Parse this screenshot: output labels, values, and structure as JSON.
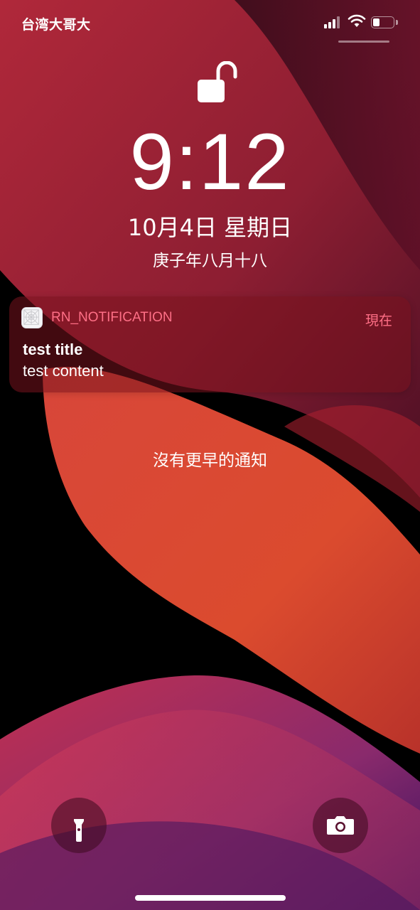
{
  "status_bar": {
    "carrier": "台湾大哥大",
    "signal_icon": "signal-bars-icon",
    "wifi_icon": "wifi-icon",
    "battery_icon": "battery-icon",
    "battery_level": 0.35
  },
  "lock_screen": {
    "lock_icon": "unlocked-padlock-icon",
    "time": "9:12",
    "date": "10月4日 星期日",
    "lunar_date": "庚子年八月十八"
  },
  "notification": {
    "app_icon": "app-placeholder-icon",
    "app_name": "RN_NOTIFICATION",
    "time": "現在",
    "title": "test title",
    "body": "test content"
  },
  "no_older_notifications": "沒有更早的通知",
  "bottom_controls": {
    "flashlight_icon": "flashlight-icon",
    "camera_icon": "camera-icon"
  },
  "colors": {
    "accent": "#ff6f86",
    "notification_bg": "#78121e"
  }
}
